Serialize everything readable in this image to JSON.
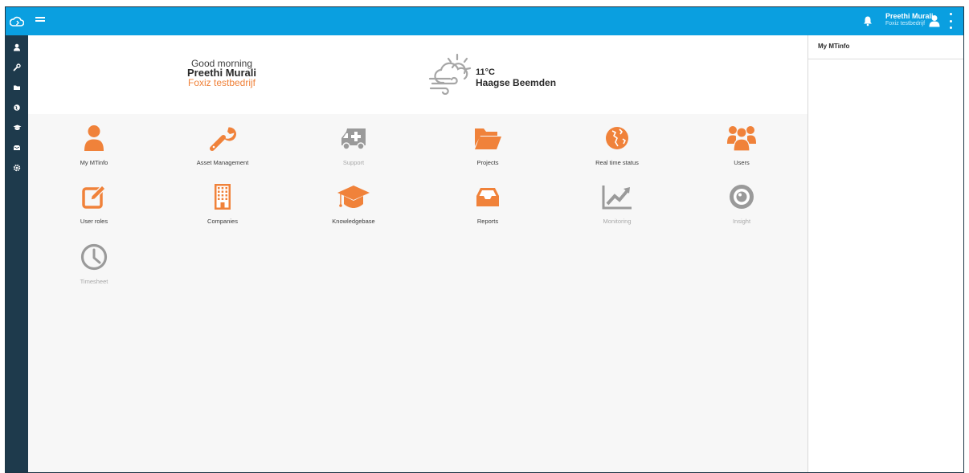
{
  "header": {
    "logo_icon": "cloud-icon",
    "menu_icon": "hamburger-icon",
    "notification_icon": "bell-icon",
    "user_name": "Preethi Murali",
    "user_company": "Foxiz testbedrijf",
    "avatar_icon": "user-icon",
    "more_icon": "kebab-icon"
  },
  "sidebar": {
    "items": [
      {
        "icon": "user-icon"
      },
      {
        "icon": "wrench-icon"
      },
      {
        "icon": "folder-icon"
      },
      {
        "icon": "globe-icon"
      },
      {
        "icon": "graduation-cap-icon"
      },
      {
        "icon": "inbox-icon"
      },
      {
        "icon": "gear-icon"
      }
    ]
  },
  "hero": {
    "greeting": "Good morning",
    "name": "Preethi Murali",
    "company": "Foxiz testbedrijf",
    "weather_icon": "cloud-sun-wind-icon",
    "temperature": "11°C",
    "location": "Haagse Beemden"
  },
  "tiles": [
    {
      "label": "My MTinfo",
      "icon": "user-icon",
      "enabled": true
    },
    {
      "label": "Asset Management",
      "icon": "wrench-icon",
      "enabled": true
    },
    {
      "label": "Support",
      "icon": "ambulance-icon",
      "enabled": false
    },
    {
      "label": "Projects",
      "icon": "folder-icon",
      "enabled": true
    },
    {
      "label": "Real time status",
      "icon": "globe-icon",
      "enabled": true
    },
    {
      "label": "Users",
      "icon": "users-icon",
      "enabled": true
    },
    {
      "label": "User roles",
      "icon": "edit-icon",
      "enabled": true
    },
    {
      "label": "Companies",
      "icon": "building-icon",
      "enabled": true
    },
    {
      "label": "Knowledgebase",
      "icon": "graduation-cap-icon",
      "enabled": true
    },
    {
      "label": "Reports",
      "icon": "inbox-icon",
      "enabled": true
    },
    {
      "label": "Monitoring",
      "icon": "line-chart-icon",
      "enabled": false
    },
    {
      "label": "Insight",
      "icon": "eye-icon",
      "enabled": false
    },
    {
      "label": "Timesheet",
      "icon": "clock-icon",
      "enabled": false
    }
  ],
  "right_panel": {
    "title": "My MTinfo"
  },
  "colors": {
    "topbar": "#0a9fe0",
    "sidebar": "#1e3a4c",
    "accent": "#f0823a",
    "disabled": "#9a9a9a"
  }
}
